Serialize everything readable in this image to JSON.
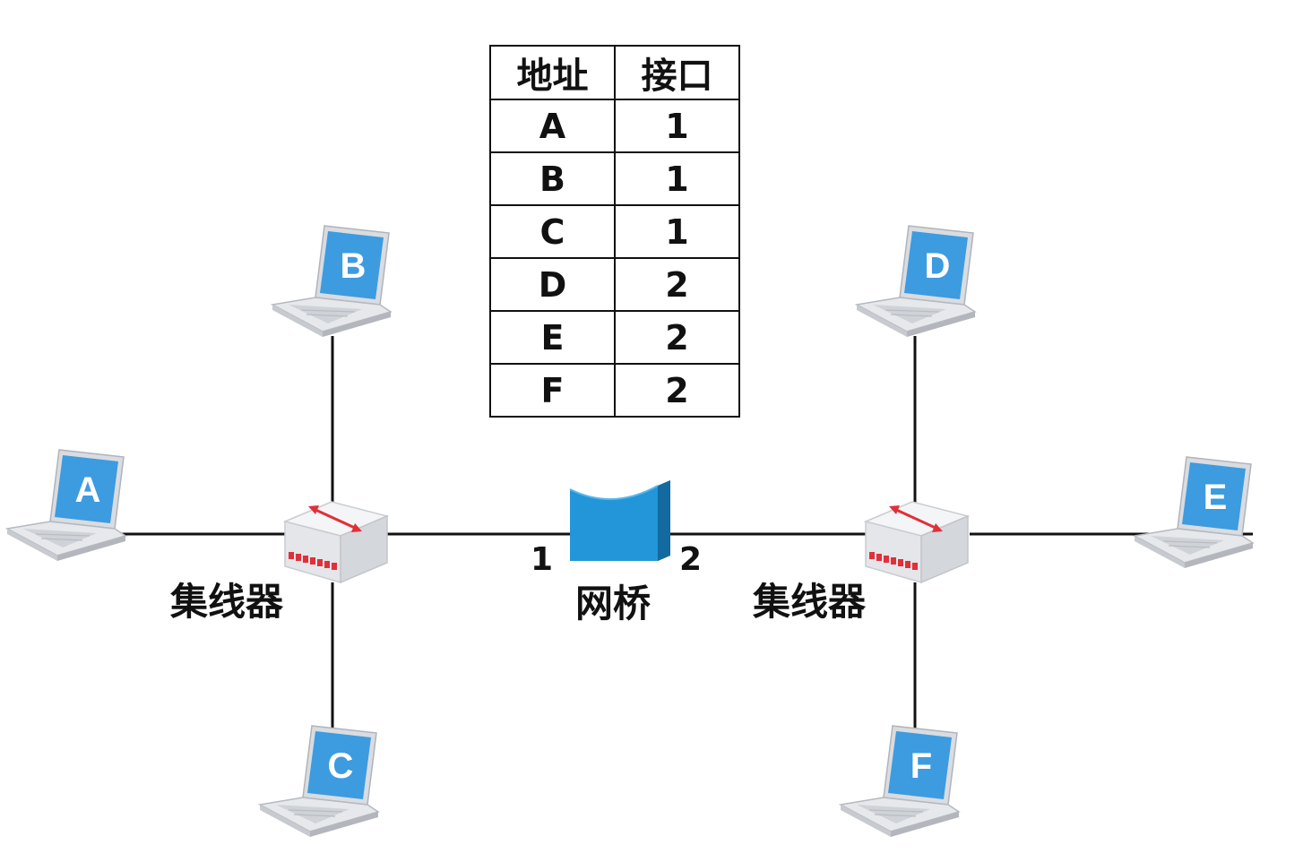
{
  "table": {
    "headers": [
      "地址",
      "接口"
    ],
    "rows": [
      [
        "A",
        "1"
      ],
      [
        "B",
        "1"
      ],
      [
        "C",
        "1"
      ],
      [
        "D",
        "2"
      ],
      [
        "E",
        "2"
      ],
      [
        "F",
        "2"
      ]
    ]
  },
  "hosts": {
    "a": "A",
    "b": "B",
    "c": "C",
    "d": "D",
    "e": "E",
    "f": "F"
  },
  "labels": {
    "left_hub": "集线器",
    "right_hub": "集线器",
    "bridge": "网桥",
    "port_1": "1",
    "port_2": "2"
  },
  "colors": {
    "laptop_screen": "#3d9be0",
    "bridge": "#1f8fd0",
    "hub_arrow": "#e0303a",
    "hub_ports": "#e0303a",
    "link": "#111111"
  },
  "icons": {
    "host": "laptop-icon",
    "hub": "hub-icon",
    "bridge": "bridge-icon"
  }
}
